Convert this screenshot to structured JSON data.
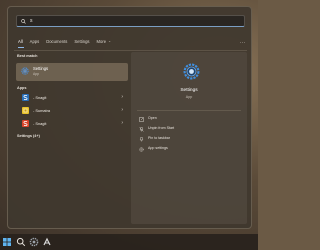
{
  "search": {
    "query": "s"
  },
  "tabs": {
    "items": [
      "All",
      "Apps",
      "Documents",
      "Settings",
      "More"
    ],
    "more_chevron": "chevron-down-icon",
    "overflow": "..."
  },
  "best_match": {
    "section_title": "Best match",
    "name": "Settings",
    "type": "App",
    "icon": "settings-gear-icon"
  },
  "apps": {
    "section_title": "Apps",
    "items": [
      {
        "label": "- Snagit",
        "icon": "snagit-icon"
      },
      {
        "label": "- Sumatra",
        "icon": "sumatra-icon"
      },
      {
        "label": "- Snagit",
        "icon": "snagit-icon"
      }
    ]
  },
  "settings_section": {
    "title": "Settings (4+)"
  },
  "detail": {
    "title": "Settings",
    "subtitle": "App",
    "actions": [
      {
        "label": "Open",
        "icon": "open-icon"
      },
      {
        "label": "Unpin from Start",
        "icon": "unpin-icon"
      },
      {
        "label": "Pin to taskbar",
        "icon": "pin-icon"
      },
      {
        "label": "App settings",
        "icon": "gear-icon"
      }
    ]
  },
  "taskbar": {
    "icons": [
      "windows-start-icon",
      "search-icon",
      "settings-icon",
      "app-icon"
    ]
  },
  "colors": {
    "accent": "#8fb8e8",
    "settings_icon_blue": "#2f7fd6"
  }
}
